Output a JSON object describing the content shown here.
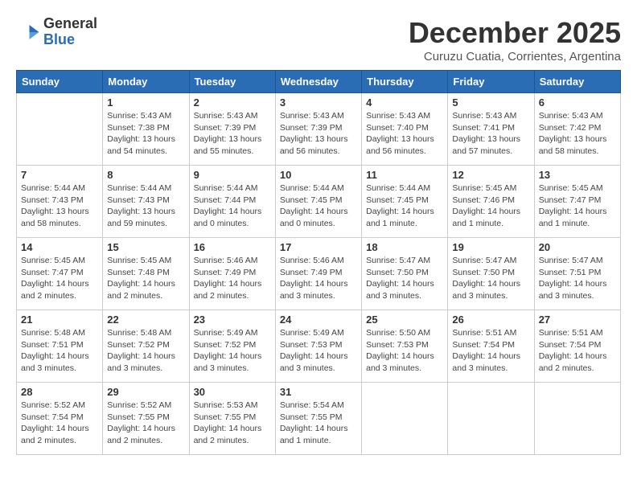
{
  "header": {
    "logo_general": "General",
    "logo_blue": "Blue",
    "month_title": "December 2025",
    "location": "Curuzu Cuatia, Corrientes, Argentina"
  },
  "days_of_week": [
    "Sunday",
    "Monday",
    "Tuesday",
    "Wednesday",
    "Thursday",
    "Friday",
    "Saturday"
  ],
  "weeks": [
    [
      {
        "day": "",
        "info": ""
      },
      {
        "day": "1",
        "info": "Sunrise: 5:43 AM\nSunset: 7:38 PM\nDaylight: 13 hours\nand 54 minutes."
      },
      {
        "day": "2",
        "info": "Sunrise: 5:43 AM\nSunset: 7:39 PM\nDaylight: 13 hours\nand 55 minutes."
      },
      {
        "day": "3",
        "info": "Sunrise: 5:43 AM\nSunset: 7:39 PM\nDaylight: 13 hours\nand 56 minutes."
      },
      {
        "day": "4",
        "info": "Sunrise: 5:43 AM\nSunset: 7:40 PM\nDaylight: 13 hours\nand 56 minutes."
      },
      {
        "day": "5",
        "info": "Sunrise: 5:43 AM\nSunset: 7:41 PM\nDaylight: 13 hours\nand 57 minutes."
      },
      {
        "day": "6",
        "info": "Sunrise: 5:43 AM\nSunset: 7:42 PM\nDaylight: 13 hours\nand 58 minutes."
      }
    ],
    [
      {
        "day": "7",
        "info": "Sunrise: 5:44 AM\nSunset: 7:43 PM\nDaylight: 13 hours\nand 58 minutes."
      },
      {
        "day": "8",
        "info": "Sunrise: 5:44 AM\nSunset: 7:43 PM\nDaylight: 13 hours\nand 59 minutes."
      },
      {
        "day": "9",
        "info": "Sunrise: 5:44 AM\nSunset: 7:44 PM\nDaylight: 14 hours\nand 0 minutes."
      },
      {
        "day": "10",
        "info": "Sunrise: 5:44 AM\nSunset: 7:45 PM\nDaylight: 14 hours\nand 0 minutes."
      },
      {
        "day": "11",
        "info": "Sunrise: 5:44 AM\nSunset: 7:45 PM\nDaylight: 14 hours\nand 1 minute."
      },
      {
        "day": "12",
        "info": "Sunrise: 5:45 AM\nSunset: 7:46 PM\nDaylight: 14 hours\nand 1 minute."
      },
      {
        "day": "13",
        "info": "Sunrise: 5:45 AM\nSunset: 7:47 PM\nDaylight: 14 hours\nand 1 minute."
      }
    ],
    [
      {
        "day": "14",
        "info": "Sunrise: 5:45 AM\nSunset: 7:47 PM\nDaylight: 14 hours\nand 2 minutes."
      },
      {
        "day": "15",
        "info": "Sunrise: 5:45 AM\nSunset: 7:48 PM\nDaylight: 14 hours\nand 2 minutes."
      },
      {
        "day": "16",
        "info": "Sunrise: 5:46 AM\nSunset: 7:49 PM\nDaylight: 14 hours\nand 2 minutes."
      },
      {
        "day": "17",
        "info": "Sunrise: 5:46 AM\nSunset: 7:49 PM\nDaylight: 14 hours\nand 3 minutes."
      },
      {
        "day": "18",
        "info": "Sunrise: 5:47 AM\nSunset: 7:50 PM\nDaylight: 14 hours\nand 3 minutes."
      },
      {
        "day": "19",
        "info": "Sunrise: 5:47 AM\nSunset: 7:50 PM\nDaylight: 14 hours\nand 3 minutes."
      },
      {
        "day": "20",
        "info": "Sunrise: 5:47 AM\nSunset: 7:51 PM\nDaylight: 14 hours\nand 3 minutes."
      }
    ],
    [
      {
        "day": "21",
        "info": "Sunrise: 5:48 AM\nSunset: 7:51 PM\nDaylight: 14 hours\nand 3 minutes."
      },
      {
        "day": "22",
        "info": "Sunrise: 5:48 AM\nSunset: 7:52 PM\nDaylight: 14 hours\nand 3 minutes."
      },
      {
        "day": "23",
        "info": "Sunrise: 5:49 AM\nSunset: 7:52 PM\nDaylight: 14 hours\nand 3 minutes."
      },
      {
        "day": "24",
        "info": "Sunrise: 5:49 AM\nSunset: 7:53 PM\nDaylight: 14 hours\nand 3 minutes."
      },
      {
        "day": "25",
        "info": "Sunrise: 5:50 AM\nSunset: 7:53 PM\nDaylight: 14 hours\nand 3 minutes."
      },
      {
        "day": "26",
        "info": "Sunrise: 5:51 AM\nSunset: 7:54 PM\nDaylight: 14 hours\nand 3 minutes."
      },
      {
        "day": "27",
        "info": "Sunrise: 5:51 AM\nSunset: 7:54 PM\nDaylight: 14 hours\nand 2 minutes."
      }
    ],
    [
      {
        "day": "28",
        "info": "Sunrise: 5:52 AM\nSunset: 7:54 PM\nDaylight: 14 hours\nand 2 minutes."
      },
      {
        "day": "29",
        "info": "Sunrise: 5:52 AM\nSunset: 7:55 PM\nDaylight: 14 hours\nand 2 minutes."
      },
      {
        "day": "30",
        "info": "Sunrise: 5:53 AM\nSunset: 7:55 PM\nDaylight: 14 hours\nand 2 minutes."
      },
      {
        "day": "31",
        "info": "Sunrise: 5:54 AM\nSunset: 7:55 PM\nDaylight: 14 hours\nand 1 minute."
      },
      {
        "day": "",
        "info": ""
      },
      {
        "day": "",
        "info": ""
      },
      {
        "day": "",
        "info": ""
      }
    ]
  ]
}
